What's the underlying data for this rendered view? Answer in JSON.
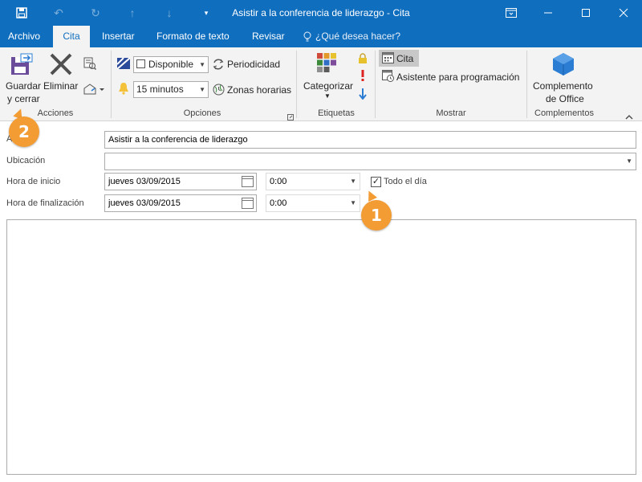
{
  "window": {
    "title": "Asistir a la conferencia de liderazgo - Cita"
  },
  "tabs": [
    {
      "label": "Archivo"
    },
    {
      "label": "Cita"
    },
    {
      "label": "Insertar"
    },
    {
      "label": "Formato de texto"
    },
    {
      "label": "Revisar"
    }
  ],
  "tell_me": "¿Qué desea hacer?",
  "ribbon": {
    "acciones": {
      "label": "Acciones",
      "save_close_line1": "Guardar",
      "save_close_line2": "y cerrar",
      "delete": "Eliminar"
    },
    "opciones": {
      "label": "Opciones",
      "show_as": "Disponible",
      "reminder": "15 minutos",
      "recurrence": "Periodicidad",
      "time_zones": "Zonas horarias"
    },
    "etiquetas": {
      "label": "Etiquetas",
      "categorize": "Categorizar"
    },
    "mostrar": {
      "label": "Mostrar",
      "appointment": "Cita",
      "scheduling": "Asistente para programación"
    },
    "complementos": {
      "label": "Complementos",
      "office_addins_line1": "Complemento",
      "office_addins_line2": "de Office"
    }
  },
  "form": {
    "subject_label": "Asunto",
    "subject_value": "Asistir a la conferencia de liderazgo",
    "location_label": "Ubicación",
    "location_value": "",
    "start_label": "Hora de inicio",
    "start_date": "jueves 03/09/2015",
    "start_time": "0:00",
    "end_label": "Hora de finalización",
    "end_date": "jueves 03/09/2015",
    "end_time": "0:00",
    "all_day_label": "Todo el día",
    "all_day_checked": true
  },
  "callouts": [
    {
      "number": "1"
    },
    {
      "number": "2"
    }
  ],
  "colors": {
    "accent": "#106ebe",
    "callout": "#f39c33"
  }
}
